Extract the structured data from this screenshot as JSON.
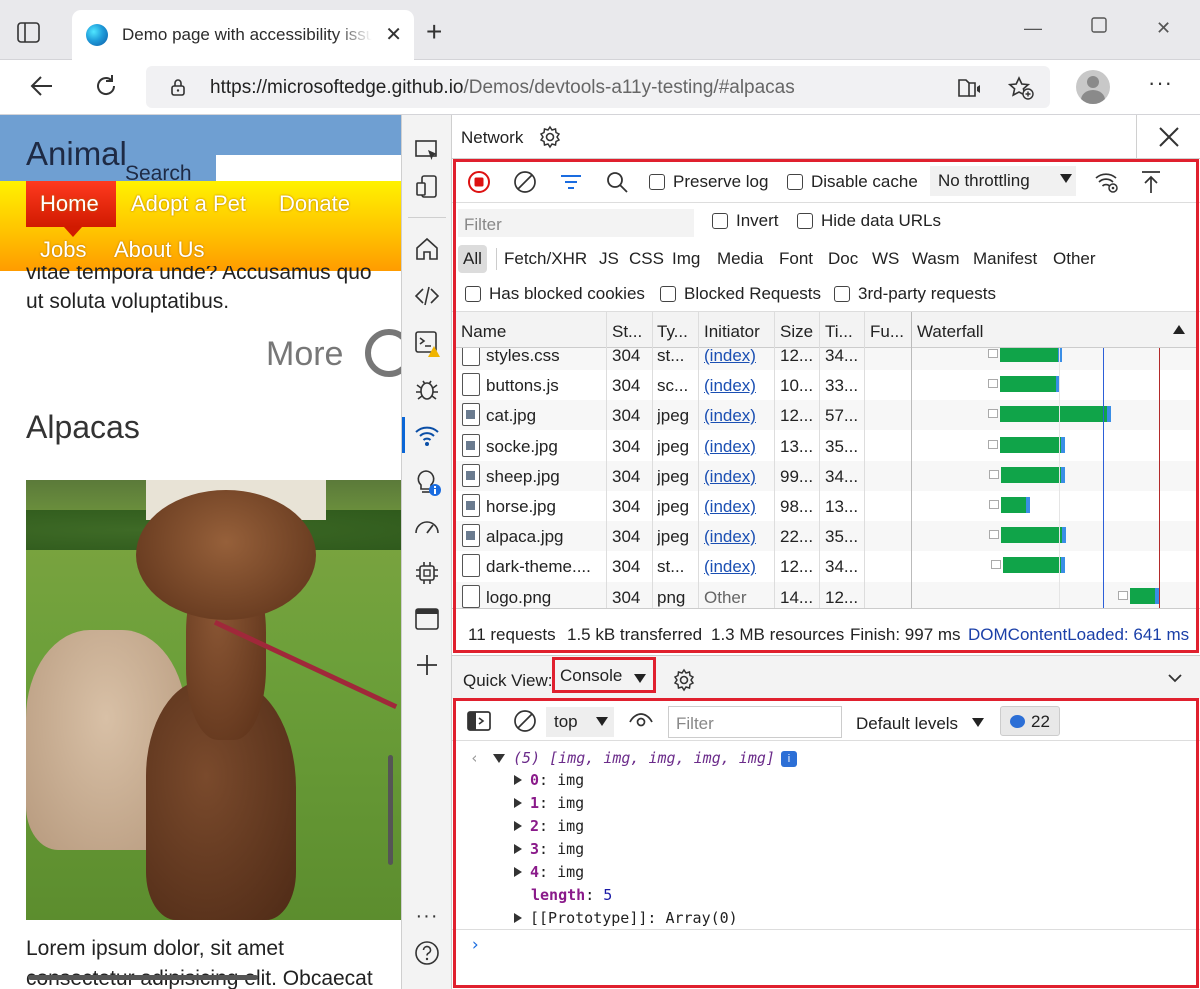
{
  "browser": {
    "tab_title": "Demo page with accessibility issues",
    "url_host": "https://microsoftedge.github.io",
    "url_path": "/Demos/devtools-a11y-testing/#alpacas"
  },
  "webpage": {
    "logo": "Animal",
    "search_label": "Search",
    "nav": [
      "Home",
      "Adopt a Pet",
      "Donate",
      "Jobs",
      "About Us"
    ],
    "text_line1": "vitae tempora unde? Accusamus quo",
    "text_line2": "ut soluta voluptatibus.",
    "more_link": "More",
    "section_heading": "Alpacas",
    "footer_line1": "Lorem ipsum dolor, sit amet",
    "footer_line2": "consectetur adipisicing elit. Obcaecat"
  },
  "devtools": {
    "panel_title": "Network",
    "toolbar": {
      "preserve_log": "Preserve log",
      "disable_cache": "Disable cache",
      "throttling": "No throttling"
    },
    "filter": {
      "placeholder": "Filter",
      "invert": "Invert",
      "hide_data_urls": "Hide data URLs"
    },
    "types": [
      "All",
      "Fetch/XHR",
      "JS",
      "CSS",
      "Img",
      "Media",
      "Font",
      "Doc",
      "WS",
      "Wasm",
      "Manifest",
      "Other"
    ],
    "blocked": {
      "has_blocked_cookies": "Has blocked cookies",
      "blocked_requests": "Blocked Requests",
      "third_party": "3rd-party requests"
    },
    "columns": [
      "Name",
      "St...",
      "Ty...",
      "Initiator",
      "Size",
      "Ti...",
      "Fu...",
      "Waterfall"
    ],
    "rows": [
      {
        "name": "styles.css",
        "status": "304",
        "type": "st...",
        "initiator": "(index)",
        "size": "12...",
        "time": "34...",
        "kind": "doc",
        "wf": [
          0.55,
          0.95
        ]
      },
      {
        "name": "buttons.js",
        "status": "304",
        "type": "sc...",
        "initiator": "(index)",
        "size": "10...",
        "time": "33...",
        "kind": "doc",
        "wf": [
          0.55,
          0.94
        ]
      },
      {
        "name": "cat.jpg",
        "status": "304",
        "type": "jpeg",
        "initiator": "(index)",
        "size": "12...",
        "time": "57...",
        "kind": "img",
        "wf": [
          0.55,
          1.28
        ]
      },
      {
        "name": "socke.jpg",
        "status": "304",
        "type": "jpeg",
        "initiator": "(index)",
        "size": "13...",
        "time": "35...",
        "kind": "img",
        "wf": [
          0.55,
          0.97
        ]
      },
      {
        "name": "sheep.jpg",
        "status": "304",
        "type": "jpeg",
        "initiator": "(index)",
        "size": "99...",
        "time": "34...",
        "kind": "img",
        "wf": [
          0.56,
          0.97
        ]
      },
      {
        "name": "horse.jpg",
        "status": "304",
        "type": "jpeg",
        "initiator": "(index)",
        "size": "98...",
        "time": "13...",
        "kind": "img",
        "wf": [
          0.56,
          0.74
        ]
      },
      {
        "name": "alpaca.jpg",
        "status": "304",
        "type": "jpeg",
        "initiator": "(index)",
        "size": "22...",
        "time": "35...",
        "kind": "img",
        "wf": [
          0.56,
          0.98
        ]
      },
      {
        "name": "dark-theme....",
        "status": "304",
        "type": "st...",
        "initiator": "(index)",
        "size": "12...",
        "time": "34...",
        "kind": "doc",
        "wf": [
          0.57,
          0.97
        ]
      },
      {
        "name": "logo.png",
        "status": "304",
        "type": "png",
        "initiator": "Other",
        "size": "14...",
        "time": "12...",
        "kind": "doc",
        "wf": [
          1.42,
          1.6
        ]
      }
    ],
    "summary": {
      "requests": "11 requests",
      "transferred": "1.5 kB transferred",
      "resources": "1.3 MB resources",
      "finish": "Finish: 997 ms",
      "dcl": "DOMContentLoaded: 641 ms"
    },
    "quick_view": {
      "label": "Quick View:",
      "selected": "Console"
    },
    "console": {
      "context": "top",
      "filter_placeholder": "Filter",
      "levels": "Default levels",
      "message_count": "22",
      "array_summary": "(5) [img, img, img, img, img]",
      "items": [
        {
          "key": "0",
          "value": "img"
        },
        {
          "key": "1",
          "value": "img"
        },
        {
          "key": "2",
          "value": "img"
        },
        {
          "key": "3",
          "value": "img"
        },
        {
          "key": "4",
          "value": "img"
        }
      ],
      "length_key": "length",
      "length_value": "5",
      "prototype_key": "[[Prototype]]",
      "prototype_value": "Array(0)"
    }
  }
}
